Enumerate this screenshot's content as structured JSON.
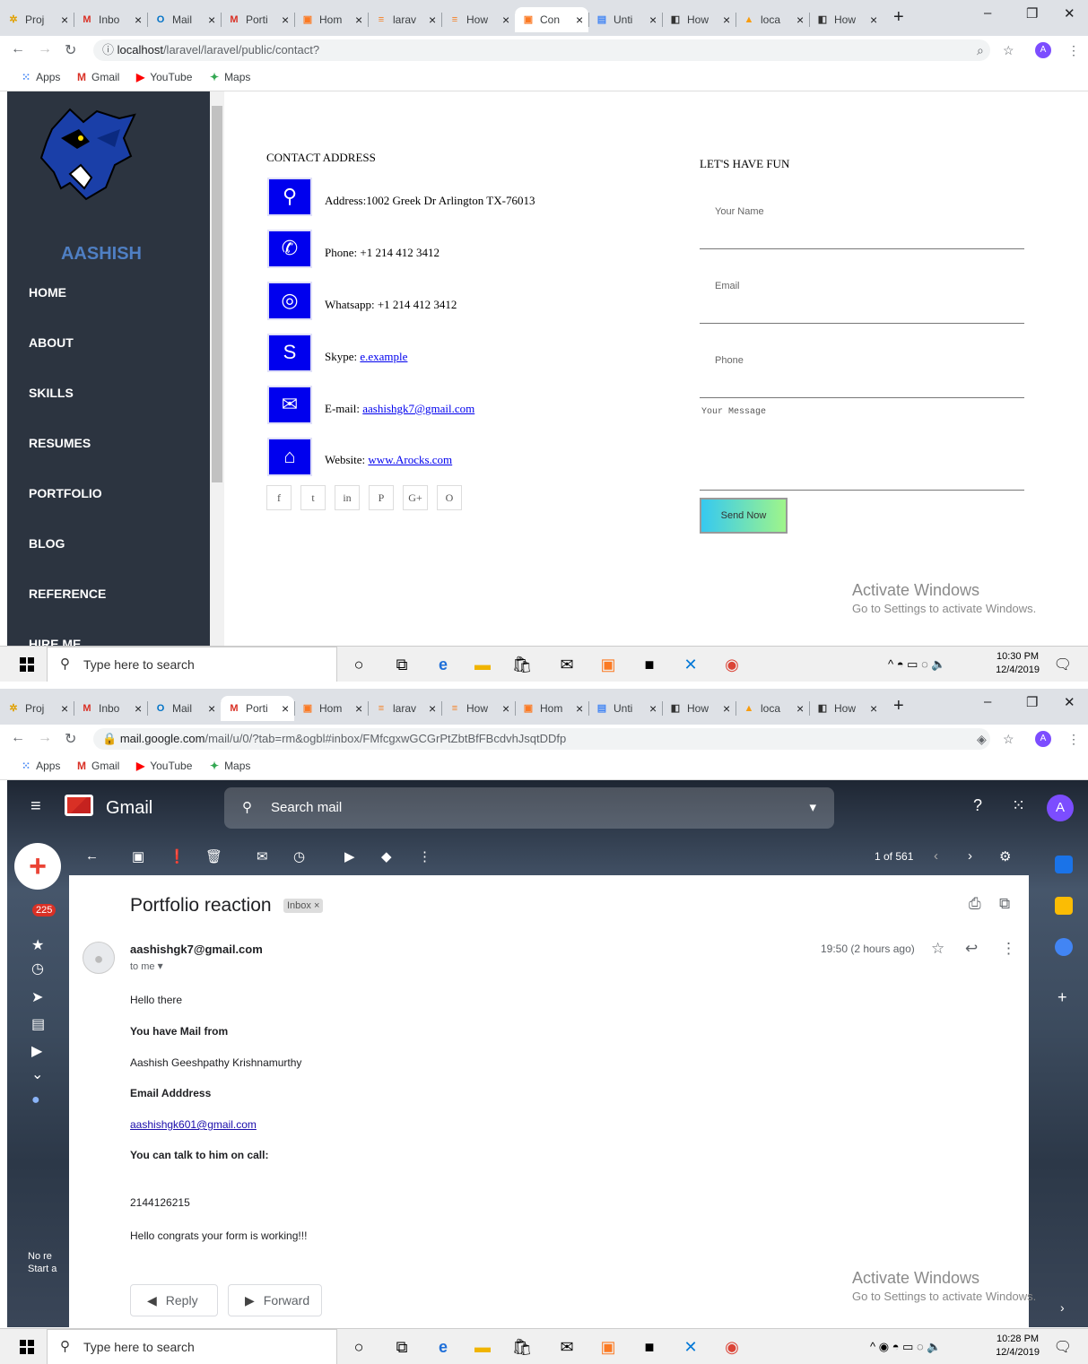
{
  "top_browser": {
    "tabs": [
      {
        "label": "Proj",
        "icon": "puzzle-icon",
        "color": "#e0a000",
        "active": false
      },
      {
        "label": "Inbo",
        "icon": "gmail-icon",
        "color": "#d93025",
        "active": false
      },
      {
        "label": "Mail",
        "icon": "outlook-icon",
        "color": "#0072c6",
        "active": false
      },
      {
        "label": "Porti",
        "icon": "gmail-icon",
        "color": "#d93025",
        "active": false
      },
      {
        "label": "Hom",
        "icon": "xampp-icon",
        "color": "#fb7a24",
        "active": false
      },
      {
        "label": "larav",
        "icon": "stackoverflow-icon",
        "color": "#f48024",
        "active": false
      },
      {
        "label": "How",
        "icon": "stackoverflow-icon",
        "color": "#f48024",
        "active": false
      },
      {
        "label": "Con",
        "icon": "xampp-icon",
        "color": "#fb7a24",
        "active": true
      },
      {
        "label": "Unti",
        "icon": "docs-icon",
        "color": "#4285f4",
        "active": false
      },
      {
        "label": "How",
        "icon": "laravel-icon",
        "color": "#333333",
        "active": false
      },
      {
        "label": "loca",
        "icon": "phpmyadmin-icon",
        "color": "#f89c0e",
        "active": false
      },
      {
        "label": "How",
        "icon": "laravel-icon",
        "color": "#333333",
        "active": false
      }
    ],
    "url_host": "localhost",
    "url_path": "/laravel/laravel/public/contact?",
    "bookmarks": [
      "Apps",
      "Gmail",
      "YouTube",
      "Maps"
    ],
    "profile_initial": "A"
  },
  "portfolio": {
    "brand": "AASHISH",
    "nav": [
      "HOME",
      "ABOUT",
      "SKILLS",
      "RESUMES",
      "PORTFOLIO",
      "BLOG",
      "REFERENCE",
      "HIRE ME"
    ],
    "contact_heading": "CONTACT ADDRESS",
    "address": "Address:1002 Greek Dr Arlington TX-76013",
    "phone": "Phone: +1 214 412 3412",
    "whatsapp": "Whatsapp: +1 214 412 3412",
    "skype_label": "Skype: ",
    "skype_link": "e.example",
    "email_label": "E-mail: ",
    "email_link": "aashishgk7@gmail.com",
    "website_label": "Website: ",
    "website_link": "www.Arocks.com",
    "social": [
      "f",
      "t",
      "in",
      "P",
      "G+",
      "O"
    ],
    "form_heading": "LET'S HAVE FUN",
    "name_placeholder": "Your Name",
    "email_placeholder": "Email",
    "phone_placeholder": "Phone",
    "message_placeholder": "Your Message",
    "send_label": "Send Now",
    "activate_title": "Activate Windows",
    "activate_sub": "Go to Settings to activate Windows."
  },
  "taskbar1": {
    "search": "Type here to search",
    "time": "10:30 PM",
    "date": "12/4/2019"
  },
  "bottom_browser": {
    "tabs": [
      {
        "label": "Proj",
        "icon": "puzzle-icon",
        "color": "#e0a000",
        "active": false
      },
      {
        "label": "Inbo",
        "icon": "gmail-icon",
        "color": "#d93025",
        "active": false
      },
      {
        "label": "Mail",
        "icon": "outlook-icon",
        "color": "#0072c6",
        "active": false
      },
      {
        "label": "Porti",
        "icon": "gmail-icon",
        "color": "#d93025",
        "active": true
      },
      {
        "label": "Hom",
        "icon": "xampp-icon",
        "color": "#fb7a24",
        "active": false
      },
      {
        "label": "larav",
        "icon": "stackoverflow-icon",
        "color": "#f48024",
        "active": false
      },
      {
        "label": "How",
        "icon": "stackoverflow-icon",
        "color": "#f48024",
        "active": false
      },
      {
        "label": "Hom",
        "icon": "xampp-icon",
        "color": "#fb7a24",
        "active": false
      },
      {
        "label": "Unti",
        "icon": "docs-icon",
        "color": "#4285f4",
        "active": false
      },
      {
        "label": "How",
        "icon": "laravel-icon",
        "color": "#333333",
        "active": false
      },
      {
        "label": "loca",
        "icon": "phpmyadmin-icon",
        "color": "#f89c0e",
        "active": false
      },
      {
        "label": "How",
        "icon": "laravel-icon",
        "color": "#333333",
        "active": false
      }
    ],
    "url_host": "mail.google.com",
    "url_path": "/mail/u/0/?tab=rm&ogbl#inbox/FMfcgxwGCGrPtZbtBfFBcdvhJsqtDDfp"
  },
  "gmail": {
    "app_name": "Gmail",
    "search_placeholder": "Search mail",
    "pager": "1 of 561",
    "unread_count": "225",
    "subject": "Portfolio reaction",
    "label": "Inbox ×",
    "sender": "aashishgk7@gmail.com",
    "to": "to me",
    "time": "19:50 (2 hours ago)",
    "body": {
      "greeting": "Hello there",
      "mail_from": "You have Mail from",
      "name": "Aashish Geeshpathy Krishnamurthy",
      "email_heading": "Email Adddress",
      "email": "aashishgk601@gmail.com",
      "call_heading": "You can talk to him on call:",
      "phone": "2144126215",
      "message": "Hello congrats your form is working!!!"
    },
    "reply_label": "Reply",
    "forward_label": "Forward",
    "side_text_1": "No re",
    "side_text_2": "Start a",
    "activate_title": "Activate Windows",
    "activate_sub": "Go to Settings to activate Windows."
  },
  "taskbar2": {
    "search": "Type here to search",
    "time": "10:28 PM",
    "date": "12/4/2019"
  }
}
